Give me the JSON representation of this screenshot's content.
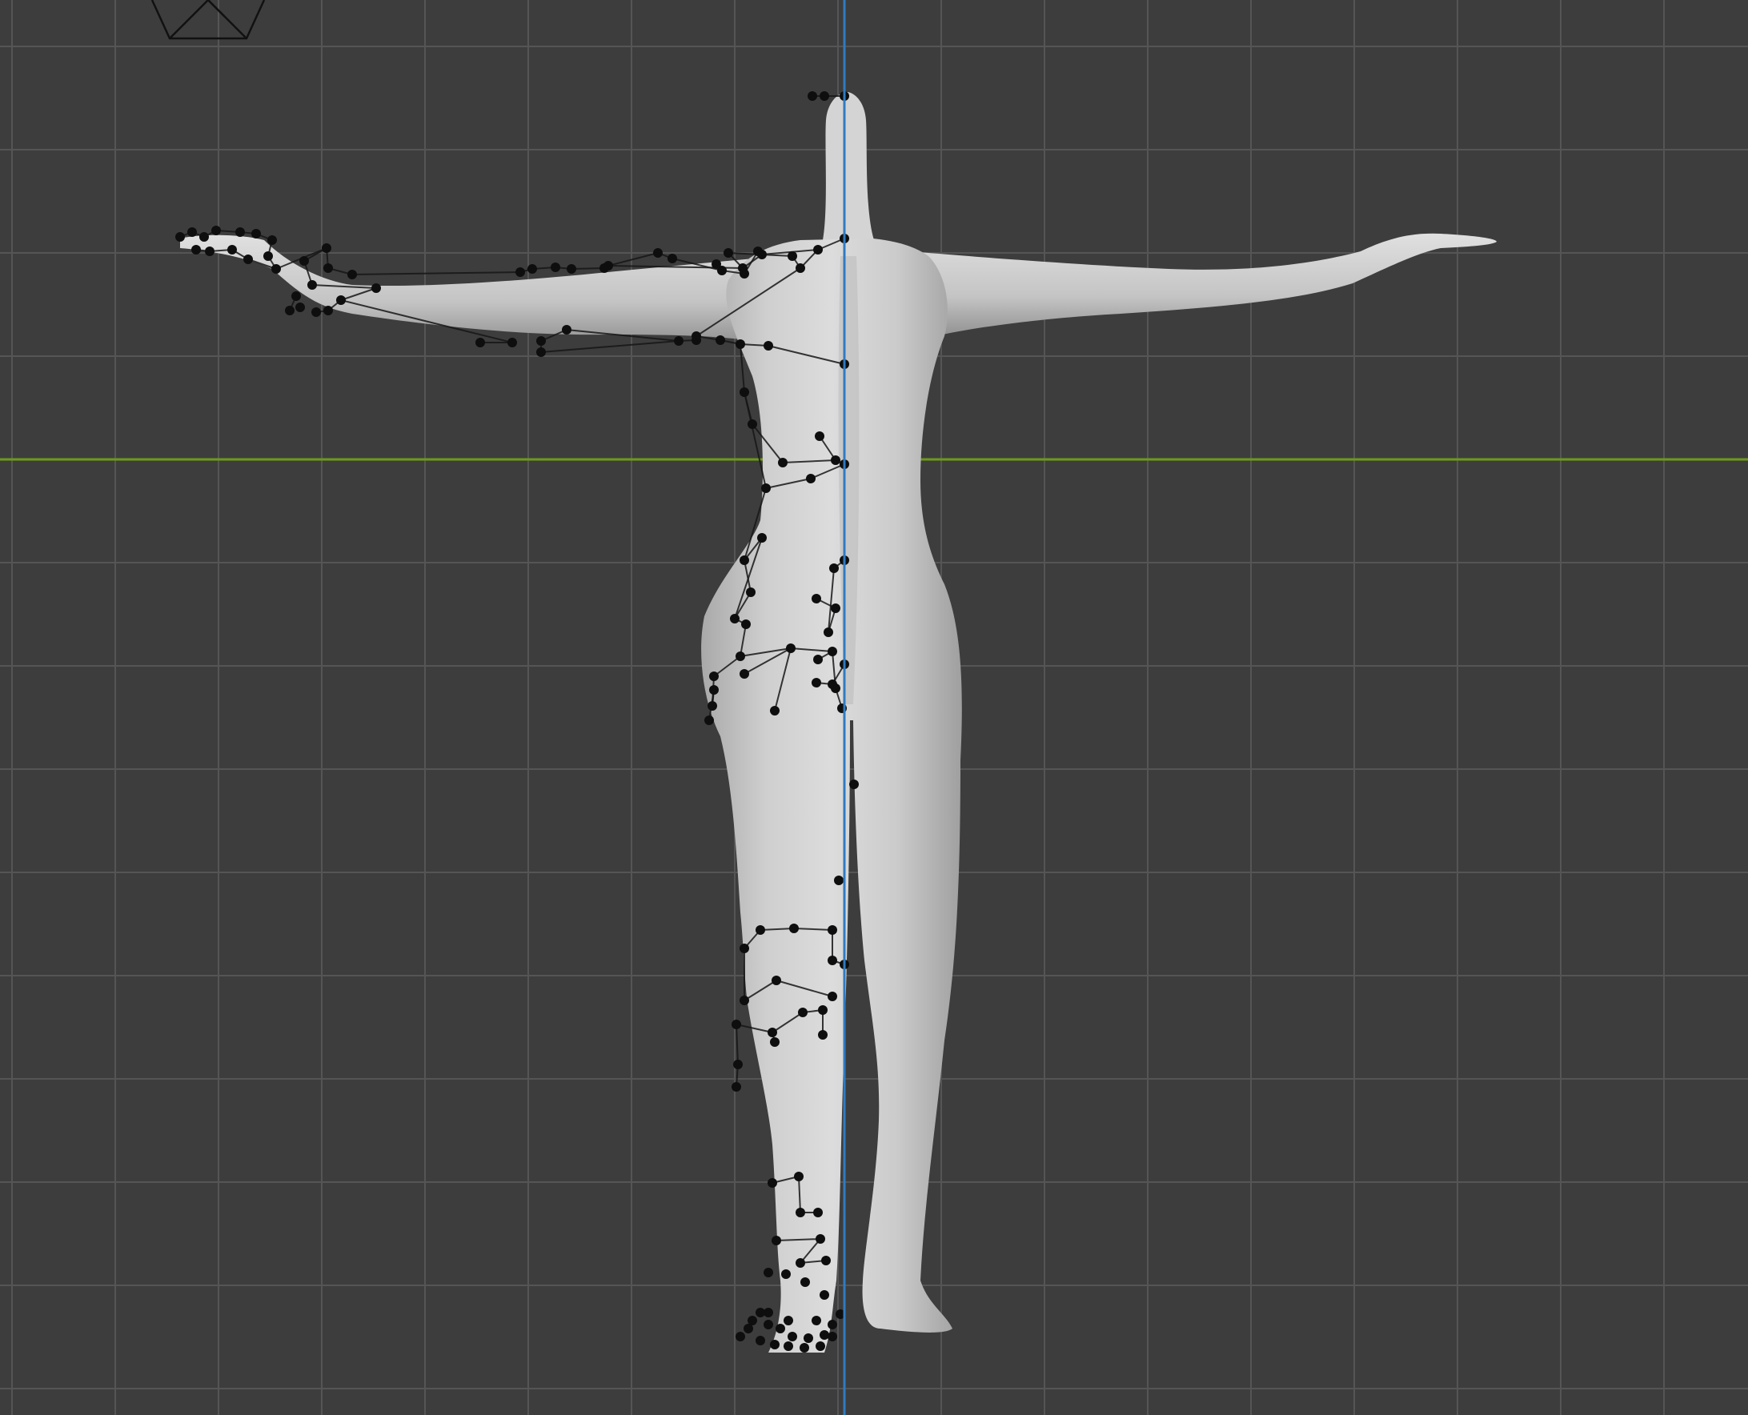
{
  "viewport": {
    "background": "#3d3d3d",
    "grid_minor_color": "#474747",
    "grid_major_color": "#555555",
    "x_axis_color": "#6e9a1a",
    "z_axis_color": "#2f7bc2",
    "mesh_color": "#c8c8c8",
    "vertex_color": "#0e0e0e",
    "edge_color": "#161616"
  },
  "objects": {
    "camera": "camera-icon",
    "mesh": "human-base-mesh"
  }
}
